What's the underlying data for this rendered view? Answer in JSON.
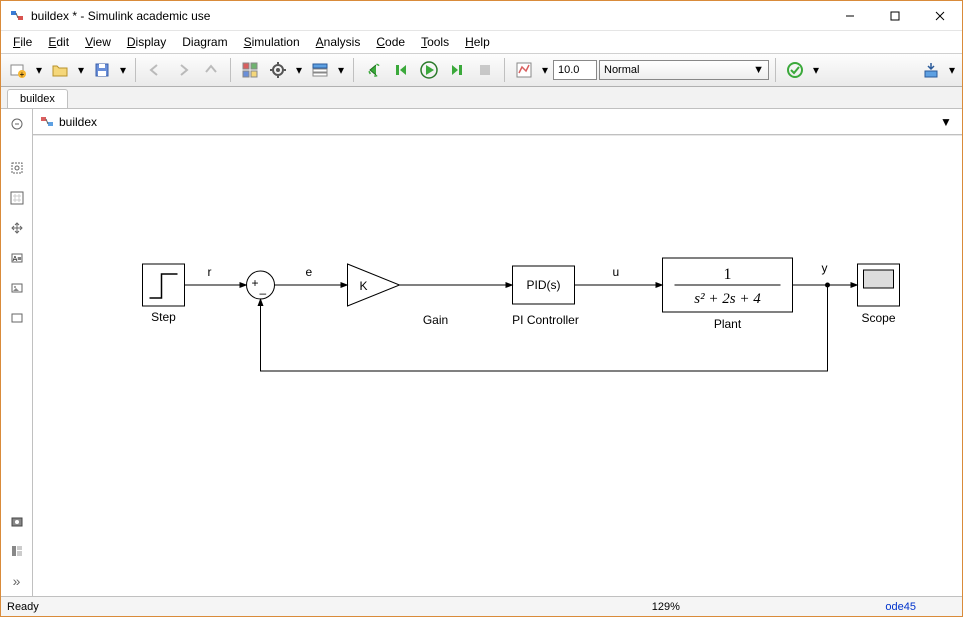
{
  "titlebar": {
    "title": "buildex * - Simulink academic use"
  },
  "menubar": {
    "items": [
      "File",
      "Edit",
      "View",
      "Display",
      "Diagram",
      "Simulation",
      "Analysis",
      "Code",
      "Tools",
      "Help"
    ]
  },
  "toolbar": {
    "stop_time": "10.0",
    "mode": "Normal"
  },
  "tabs": {
    "active": "buildex"
  },
  "breadcrumb": {
    "model": "buildex"
  },
  "diagram": {
    "blocks": {
      "step": {
        "label": "Step"
      },
      "gain": {
        "label": "Gain",
        "symbol": "K"
      },
      "pid": {
        "label": "PI Controller",
        "text": "PID(s)"
      },
      "plant": {
        "label": "Plant",
        "numerator": "1",
        "denominator": "s² + 2s + 4"
      },
      "scope": {
        "label": "Scope"
      }
    },
    "signals": {
      "r": "r",
      "e": "e",
      "u": "u",
      "y": "y"
    }
  },
  "status": {
    "left": "Ready",
    "center": "129%",
    "solver": "ode45"
  },
  "icons": {
    "min": "—",
    "max": "☐",
    "close": "✕",
    "dd": "▾",
    "dd2": "▼"
  }
}
